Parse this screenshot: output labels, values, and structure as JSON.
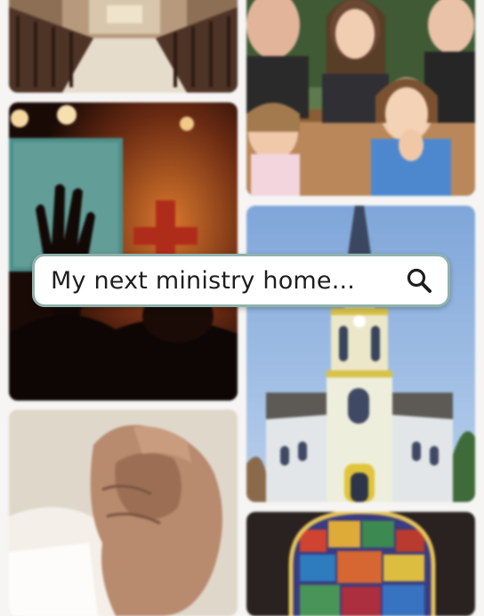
{
  "search": {
    "text": "My next ministry home...",
    "icon": "search-icon"
  },
  "colors": {
    "search_border": "#8fb2ad",
    "background": "#f6f5f3"
  },
  "tiles": [
    {
      "name": "church-interior-pews-photo"
    },
    {
      "name": "family-in-pews-photo"
    },
    {
      "name": "raised-hand-worship-photo"
    },
    {
      "name": "yellow-white-church-building-photo"
    },
    {
      "name": "praying-hands-bible-photo"
    },
    {
      "name": "stained-glass-window-photo"
    }
  ]
}
